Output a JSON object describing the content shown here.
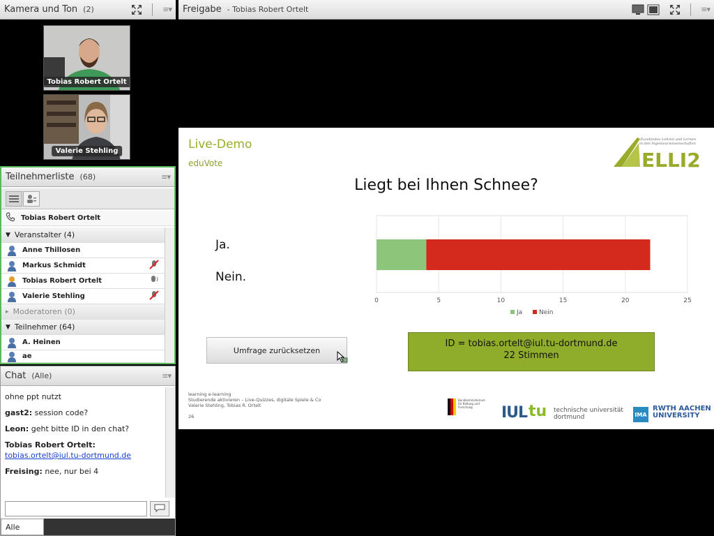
{
  "camera_pod": {
    "title": "Kamera und Ton",
    "count": "(2)",
    "videos": [
      {
        "name": "Tobias Robert Ortelt"
      },
      {
        "name": "Valerie Stehling"
      }
    ]
  },
  "participants_pod": {
    "title": "Teilnehmerliste",
    "count": "(68)",
    "caller": "Tobias Robert Ortelt",
    "groups": {
      "hosts_label": "Veranstalter (4)",
      "presenters_label": "Moderatoren (0)",
      "participants_label": "Teilnehmer (64)"
    },
    "hosts": [
      {
        "name": "Anne Thillosen",
        "status": ""
      },
      {
        "name": "Markus Schmidt",
        "status": "mic-muted"
      },
      {
        "name": "Tobias Robert Ortelt",
        "status": "speaking"
      },
      {
        "name": "Valerie Stehling",
        "status": "mic-muted"
      }
    ],
    "participants": [
      {
        "name": "A. Heinen"
      },
      {
        "name": "ae"
      }
    ]
  },
  "chat_pod": {
    "title": "Chat",
    "scope": "(Alle)",
    "messages": [
      {
        "sender": "",
        "text": "ohne ppt nutzt",
        "link": ""
      },
      {
        "sender": "gast2:",
        "text": "session code?",
        "link": ""
      },
      {
        "sender": "Leon:",
        "text": "geht bitte ID in den chat?",
        "link": ""
      },
      {
        "sender": "Tobias Robert Ortelt:",
        "text": "",
        "link": "tobias.ortelt@iul.tu-dortmund.de"
      },
      {
        "sender": "Freising:",
        "text": "nee, nur bei 4",
        "link": ""
      }
    ],
    "tab_label": "Alle"
  },
  "share_pod": {
    "title": "Freigabe",
    "subtitle": "- Tobias Robert Ortelt"
  },
  "slide": {
    "heading": "Live-Demo",
    "subheading": "eduVote",
    "question": "Liegt bei Ihnen Schnee?",
    "answers": [
      "Ja.",
      "Nein."
    ],
    "reset_button": "Umfrage zurücksetzen",
    "id_line": "ID = tobias.ortelt@iul.tu-dortmund.de",
    "votes_line": "22 Stimmen",
    "footer_lines": [
      "learning e-learning",
      "Studierende aktivieren – Live-Quizzes, digitale Spiele & Co",
      "Valerie Stehling, Tobias R. Ortelt"
    ],
    "page_number": "26",
    "logo_elli_text": "ELLI2",
    "logo_elli_tagline": "Exzellentes Lehren und Lernen in den Ingenieurwissenschaften",
    "logo_bmbf": "Bundesministerium für Bildung und Forschung",
    "logo_iul": "IUL",
    "logo_tu": "tu",
    "logo_tu_text": "technische universität dortmund",
    "logo_ima": "IMA",
    "logo_rwth": "RWTH AACHEN UNIVERSITY",
    "colors": {
      "accent": "#8fad2a",
      "ja": "#8cc67a",
      "nein": "#d42a1e"
    }
  },
  "chart_data": {
    "type": "bar",
    "orientation": "horizontal",
    "stacked": true,
    "categories": [
      ""
    ],
    "series": [
      {
        "name": "Ja",
        "values": [
          4
        ],
        "color": "#8cc67a"
      },
      {
        "name": "Nein",
        "values": [
          18
        ],
        "color": "#d42a1e"
      }
    ],
    "xlim": [
      0,
      25
    ],
    "xticks": [
      "0",
      "5",
      "10",
      "15",
      "20",
      "25"
    ],
    "grid": true,
    "legend": "bottom"
  }
}
